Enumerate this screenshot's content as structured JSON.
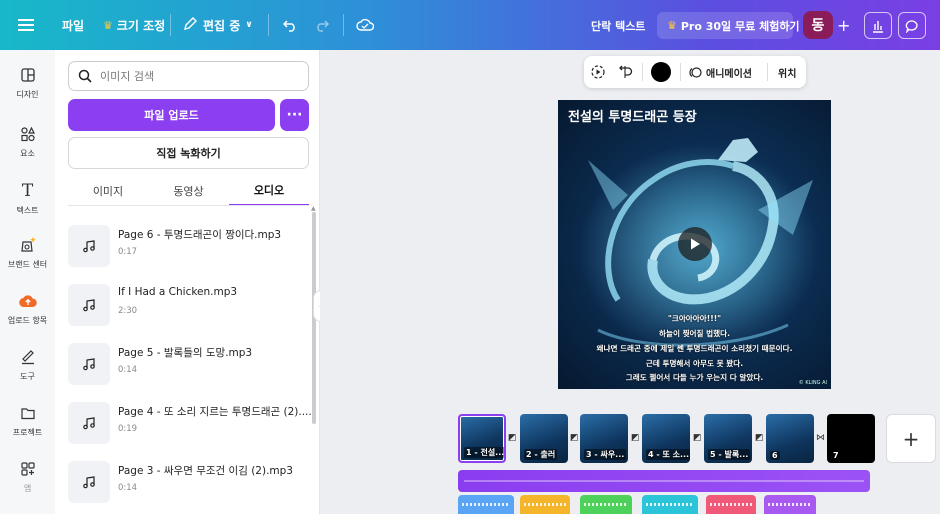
{
  "topbar": {
    "file": "파일",
    "resize": "크기 조정",
    "editing": "편집 중",
    "text_label": "단락 텍스트",
    "pro_trial": "Pro 30일 무료 체험하기",
    "avatar": "동",
    "plus": "+"
  },
  "rail": [
    {
      "label": "디자인",
      "icon": "layout-icon"
    },
    {
      "label": "요소",
      "icon": "elements-icon"
    },
    {
      "label": "텍스트",
      "icon": "text-icon"
    },
    {
      "label": "브랜드 센터",
      "icon": "brand-icon"
    },
    {
      "label": "업로드 항목",
      "icon": "upload-icon"
    },
    {
      "label": "도구",
      "icon": "draw-icon"
    },
    {
      "label": "프로젝트",
      "icon": "folder-icon"
    },
    {
      "label": "앱",
      "icon": "apps-icon"
    }
  ],
  "panel": {
    "search_placeholder": "이미지 검색",
    "upload_button": "파일 업로드",
    "more_button": "···",
    "record_button": "직접 녹화하기",
    "tabs": [
      "이미지",
      "동영상",
      "오디오"
    ],
    "audio_files": [
      {
        "name": "Page 6 - 투명드래곤이 짱이다.mp3",
        "duration": "0:17"
      },
      {
        "name": "If I Had a Chicken.mp3",
        "duration": "2:30"
      },
      {
        "name": "Page 5 - 발록들의 도망.mp3",
        "duration": "0:14"
      },
      {
        "name": "Page 4 - 또 소리 지르는 투명드래곤 (2)....",
        "duration": "0:19"
      },
      {
        "name": "Page 3 - 싸우면 무조건 이김 (2).mp3",
        "duration": "0:14"
      }
    ]
  },
  "context_toolbar": {
    "animation": "애니메이션",
    "position": "위치"
  },
  "design": {
    "title": "전설의 투명드래곤 등장",
    "lines": [
      "\"크아아아아!!!\"",
      "하늘이 찢어질 법했다.",
      "왜냐면 드래곤 중에 제일 쎈 투명드래곤이 소리쳤기 때문이다.",
      "근데 투명해서 아무도 못 봤다.",
      "그래도 쩔어서 다들 누가 우는지 다 알았다."
    ],
    "watermark": "© KLING AI"
  },
  "timeline": {
    "pages": [
      "1 - 전설...",
      "2 - 출러",
      "3 - 싸우...",
      "4 - 또 소...",
      "5 - 발록...",
      "6",
      "7"
    ],
    "add_page": "+"
  },
  "colors": {
    "accent": "#8b3ff0",
    "topbar_start": "#18b8c9",
    "topbar_end": "#7a3fe4"
  }
}
